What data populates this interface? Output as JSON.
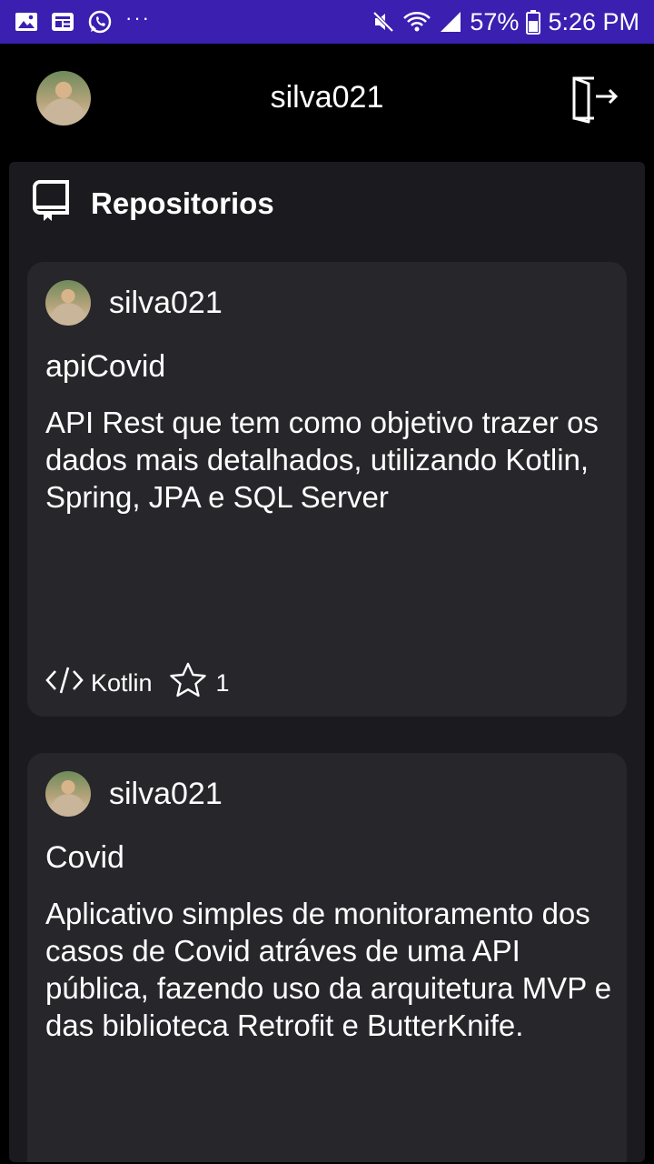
{
  "status_bar": {
    "battery": "57%",
    "time": "5:26 PM",
    "icons": [
      "image-icon",
      "news-icon",
      "whatsapp-icon",
      "more-icon",
      "mute-icon",
      "wifi-icon",
      "signal-icon",
      "battery-icon"
    ]
  },
  "app_bar": {
    "title": "silva021",
    "logout_icon": "logout-icon"
  },
  "section": {
    "icon": "repository-icon",
    "title": "Repositorios"
  },
  "repos": [
    {
      "user": "silva021",
      "name": "apiCovid",
      "description": "API Rest que tem como objetivo trazer os dados mais detalhados, utilizando Kotlin, Spring, JPA e SQL Server",
      "language": "Kotlin",
      "stars": "1"
    },
    {
      "user": "silva021",
      "name": "Covid",
      "description": "Aplicativo simples de monitoramento dos casos de Covid atráves de uma API pública, fazendo uso da arquitetura MVP e das biblioteca Retrofit e ButterKnife."
    }
  ],
  "colors": {
    "status_bar": "#3a1fb0",
    "background": "#000000",
    "panel": "#1b1b1f",
    "card": "#26262b",
    "text": "#ffffff"
  }
}
